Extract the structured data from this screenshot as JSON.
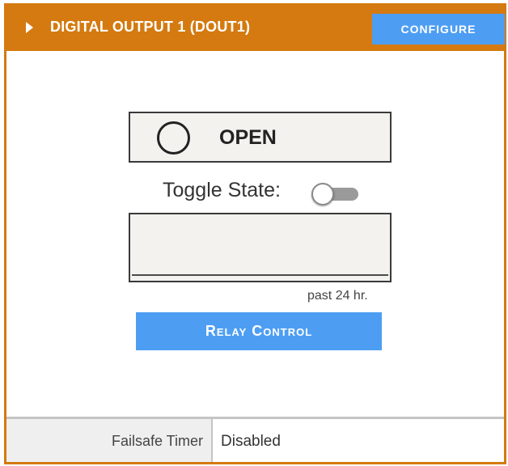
{
  "header": {
    "title": "DIGITAL OUTPUT 1 (DOUT1)",
    "configure_label": "CONFIGURE",
    "expand_icon": "caret-right-icon"
  },
  "state": {
    "label": "OPEN",
    "indicator_icon": "circle-open-icon"
  },
  "toggle": {
    "label": "Toggle State:",
    "value": false
  },
  "history": {
    "caption": "past 24 hr."
  },
  "relay": {
    "button_label": "Relay Control"
  },
  "footer": {
    "failsafe_label": "Failsafe Timer",
    "failsafe_value": "Disabled"
  },
  "colors": {
    "accent": "#d47a10",
    "button": "#4d9ef3"
  }
}
